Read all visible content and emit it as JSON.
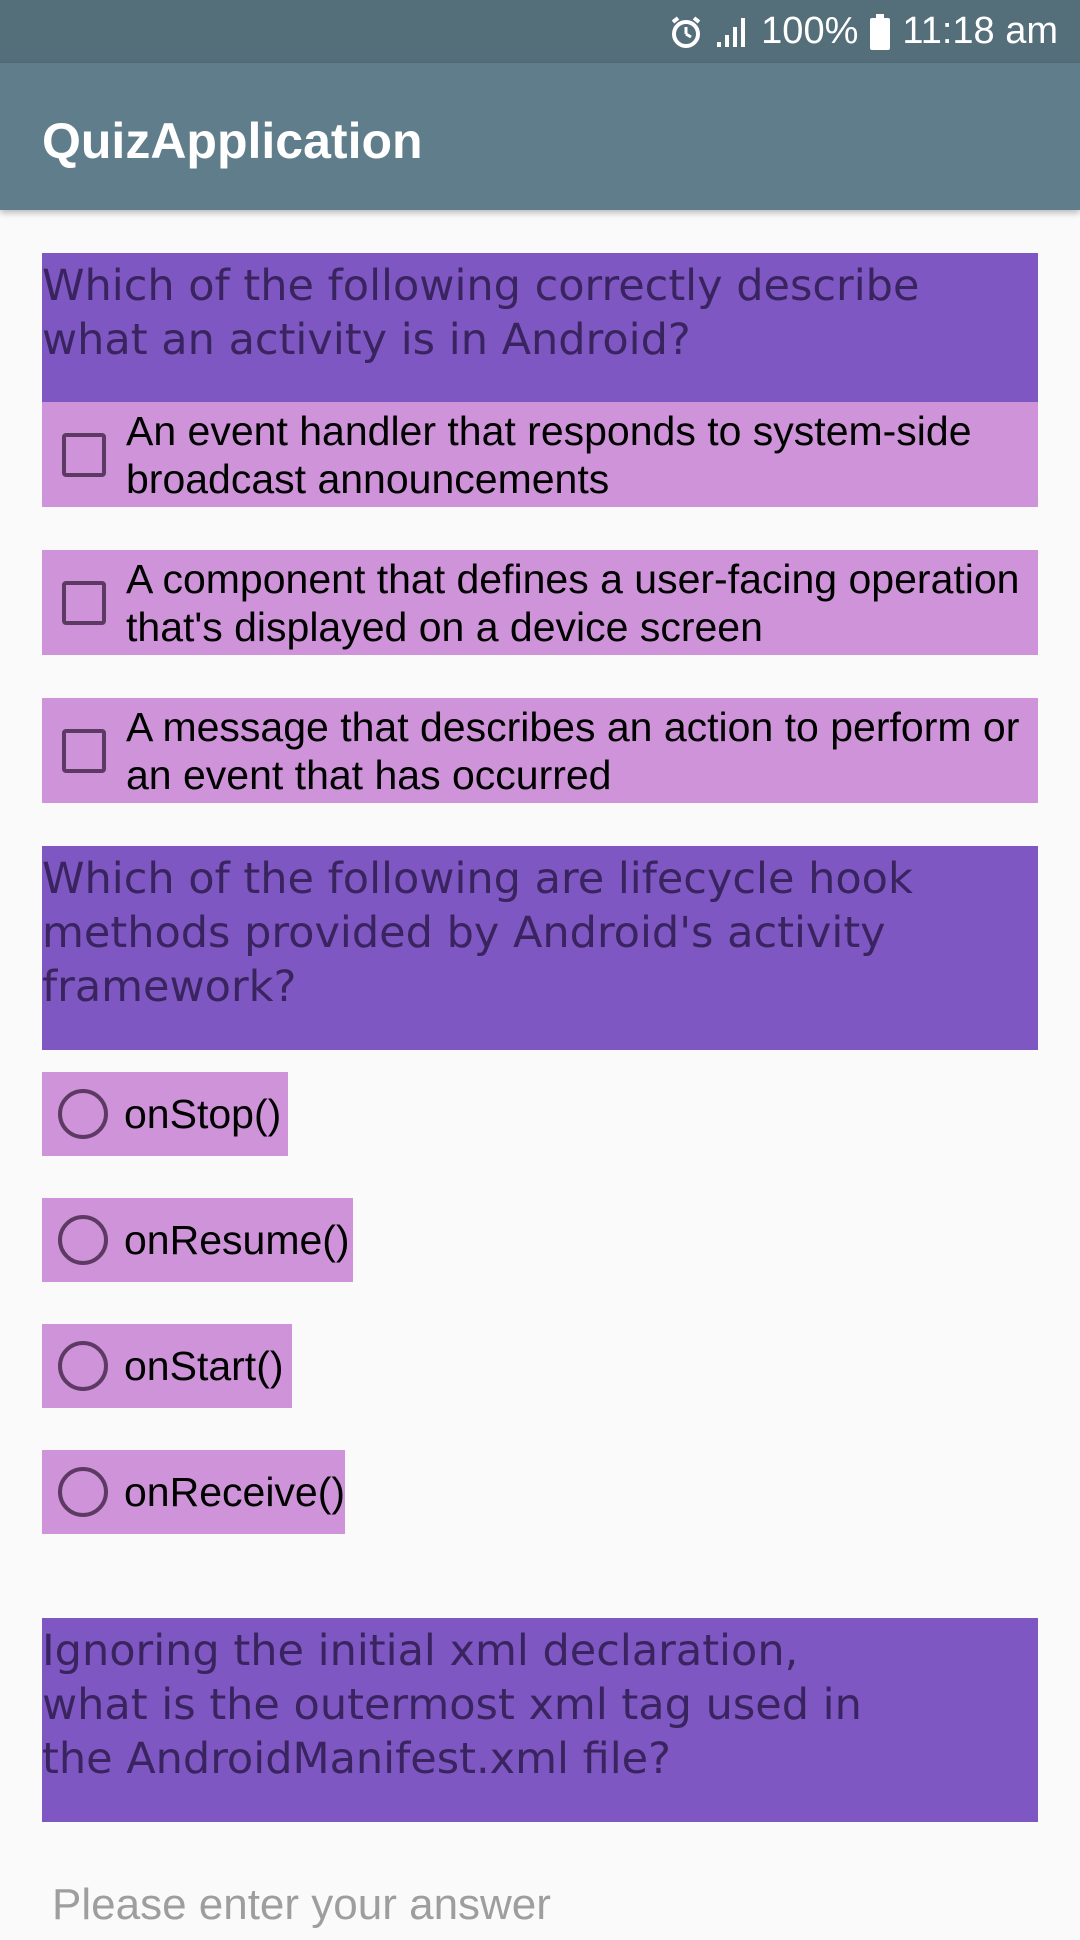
{
  "status_bar": {
    "battery": "100%",
    "time": "11:18 am",
    "icons": [
      "alarm-icon",
      "signal-icon",
      "battery-icon"
    ]
  },
  "app_bar": {
    "title": "QuizApplication"
  },
  "colors": {
    "status_bar": "#546E7A",
    "app_bar": "#607D8B",
    "question_bg": "#7E57C2",
    "option_bg": "#CE93D8",
    "background": "#FAFAFA"
  },
  "questions": [
    {
      "text": "Which of the following correctly describe what an activity is in Android?",
      "type": "checkbox",
      "options": [
        {
          "label": "An event handler that responds to system-side broadcast announcements",
          "checked": false
        },
        {
          "label": "A component that defines a user-facing operation that's displayed on a device screen",
          "checked": false
        },
        {
          "label": "A message that describes an action to perform or an event that has occurred",
          "checked": false
        }
      ]
    },
    {
      "text": "Which of the following are lifecycle hook methods provided by Android's activity framework?",
      "type": "radio",
      "options": [
        {
          "label": "onStop()",
          "checked": false
        },
        {
          "label": "onResume()",
          "checked": false
        },
        {
          "label": "onStart()",
          "checked": false
        },
        {
          "label": "onReceive()",
          "checked": false
        }
      ]
    },
    {
      "text": "Ignoring the initial xml declaration, what is the outermost xml tag used in the AndroidManifest.xml file?",
      "type": "text",
      "input": {
        "value": "",
        "placeholder": "Please enter your answer"
      }
    }
  ]
}
